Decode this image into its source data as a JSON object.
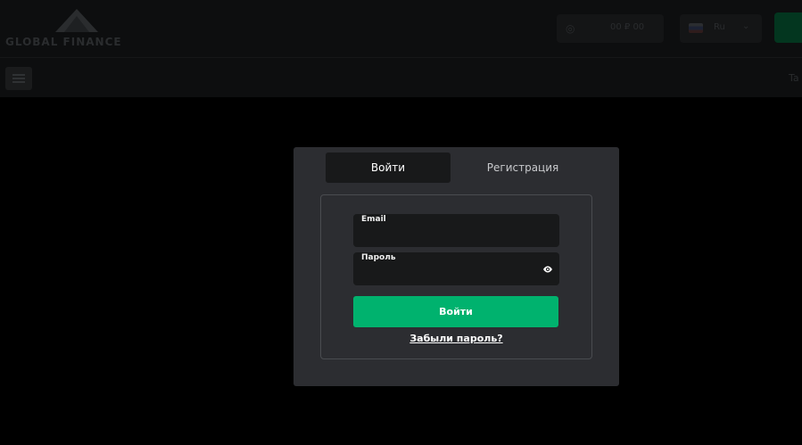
{
  "header": {
    "logo_text": "GLOBAL FINANCE",
    "balance": "00 ₽ 00",
    "language": "Ru"
  },
  "modal": {
    "tabs": [
      {
        "label": "Войти",
        "active": true
      },
      {
        "label": "Регистрация",
        "active": false
      }
    ],
    "email_label": "Email",
    "email_value": "",
    "password_label": "Пароль",
    "password_value": "",
    "password_toggle_icon": "eye-icon",
    "submit_label": "Войти",
    "forgot_label": "Забыли пароль?"
  },
  "colors": {
    "accent_green": "#00b26e",
    "modal_bg": "#2c2d31",
    "field_bg": "#18191a",
    "page_bg": "#000000"
  }
}
